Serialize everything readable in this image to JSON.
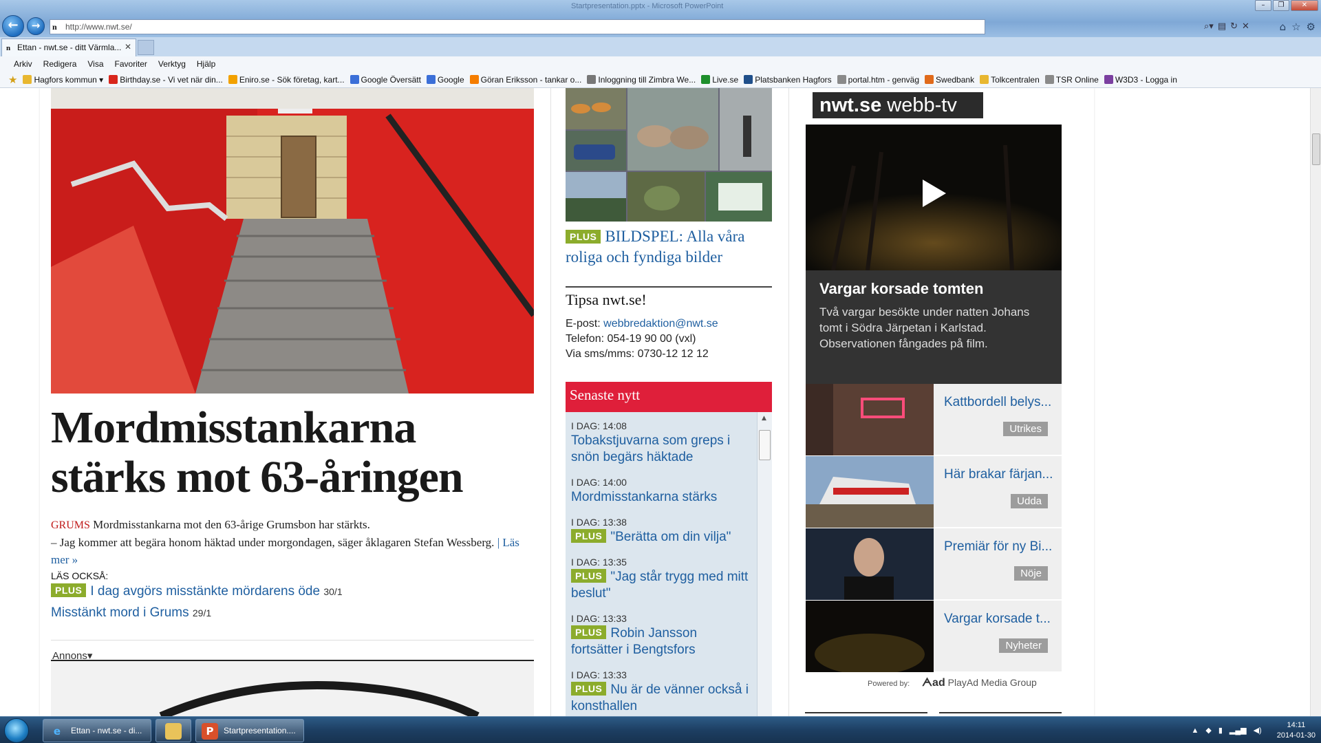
{
  "browser": {
    "title_caption": "Startpresentation.pptx - Microsoft PowerPoint",
    "url": "http://www.nwt.se/",
    "tab_title": "Ettan - nwt.se - ditt Värmla...",
    "menu": [
      "Arkiv",
      "Redigera",
      "Visa",
      "Favoriter",
      "Verktyg",
      "Hjälp"
    ],
    "favorites": [
      {
        "label": "Hagfors kommun ▾",
        "icon": "folder-icon",
        "color": "#e8b730"
      },
      {
        "label": "Birthday.se - Vi vet när din...",
        "icon": "heart-icon",
        "color": "#d8261c"
      },
      {
        "label": "Eniro.se - Sök företag, kart...",
        "icon": "eniro-icon",
        "color": "#f2a100"
      },
      {
        "label": "Google Översätt",
        "icon": "translate-icon",
        "color": "#3b6fd8"
      },
      {
        "label": "Google",
        "icon": "google-icon",
        "color": "#3b6fd8"
      },
      {
        "label": "Göran Eriksson - tankar o...",
        "icon": "blogger-icon",
        "color": "#f57d00"
      },
      {
        "label": "Inloggning till Zimbra We...",
        "icon": "zimbra-icon",
        "color": "#777777"
      },
      {
        "label": "Live.se",
        "icon": "windows-icon",
        "color": "#1e8f2c"
      },
      {
        "label": "Platsbanken Hagfors",
        "icon": "platsbanken-icon",
        "color": "#1f4f8a"
      },
      {
        "label": "portal.htm - genväg",
        "icon": "page-icon",
        "color": "#8a8a8a"
      },
      {
        "label": "Swedbank",
        "icon": "swedbank-icon",
        "color": "#e06a1a"
      },
      {
        "label": "Tolkcentralen",
        "icon": "sun-icon",
        "color": "#e8b730"
      },
      {
        "label": "TSR Online",
        "icon": "page-icon",
        "color": "#8a8a8a"
      },
      {
        "label": "W3D3 - Logga in",
        "icon": "w3d3-icon",
        "color": "#7b3fa0"
      }
    ]
  },
  "article": {
    "headline": "Mordmisstankarna stärks mot 63-åringen",
    "location": "GRUMS",
    "lead_line1": "Mordmisstankarna mot den 63-årige Grumsbon har stärkts.",
    "lead_line2": "– Jag kommer att begära honom häktad under morgondagen, säger åklagaren Stefan Wessberg.",
    "separator": "|",
    "read_more": "Läs mer »",
    "also_read_label": "LÄS OCKSÅ:",
    "related": [
      {
        "plus": "PLUS",
        "title": "I dag avgörs misstänkte mördarens öde",
        "date": "30/1"
      },
      {
        "plus": "",
        "title": "Misstänkt mord i Grums",
        "date": "29/1"
      }
    ],
    "ad_label": "Annons▾"
  },
  "middle": {
    "bildspel_plus": "PLUS",
    "bildspel_title": "BILDSPEL: Alla våra roliga och fyndiga bilder",
    "tipsa_title": "Tipsa nwt.se!",
    "email_label": "E-post:",
    "email": "webbredaktion@nwt.se",
    "phone": "Telefon: 054-19 90 00 (vxl)",
    "sms": "Via sms/mms: 0730-12 12 12",
    "senaste_title": "Senaste nytt",
    "news": [
      {
        "time": "I DAG: 14:08",
        "plus": "",
        "title": "Tobakstjuvarna som greps i snön begärs häktade"
      },
      {
        "time": "I DAG: 14:00",
        "plus": "",
        "title": "Mordmisstankarna stärks"
      },
      {
        "time": "I DAG: 13:38",
        "plus": "PLUS",
        "title": "\"Berätta om din vilja\""
      },
      {
        "time": "I DAG: 13:35",
        "plus": "PLUS",
        "title": "\"Jag står trygg med mitt beslut\""
      },
      {
        "time": "I DAG: 13:33",
        "plus": "PLUS",
        "title": "Robin Jansson fortsätter i Bengtsfors"
      },
      {
        "time": "I DAG: 13:33",
        "plus": "PLUS",
        "title": "Nu är de vänner också i konsthallen"
      }
    ]
  },
  "webbtv": {
    "logo_brand": "nwt.se",
    "logo_tv": " webb-tv",
    "featured_title": "Vargar korsade tomten",
    "featured_desc": "Två vargar besökte under natten Johans tomt i Södra Järpetan i Karlstad. Observationen fångades på film.",
    "items": [
      {
        "title": "Kattbordell belys...",
        "category": "Utrikes"
      },
      {
        "title": "Här brakar färjan...",
        "category": "Udda"
      },
      {
        "title": "Premiär för ny Bi...",
        "category": "Nöje"
      },
      {
        "title": "Vargar korsade t...",
        "category": "Nyheter"
      }
    ],
    "powered_by": "Powered by:",
    "playad_logo": "ᗅad",
    "playad_name": "PlayAd Media Group"
  },
  "taskbar": {
    "items": [
      {
        "label": "Ettan - nwt.se - di...",
        "icon": "ie-icon"
      },
      {
        "label": "",
        "icon": "explorer-icon"
      },
      {
        "label": "Startpresentation....",
        "icon": "powerpoint-icon"
      }
    ],
    "time": "14:11",
    "date": "2014-01-30"
  },
  "colors": {
    "link": "#1f5fa0",
    "plus": "#8cac2c",
    "senaste": "#df1f3a",
    "location": "#c01a1a"
  }
}
